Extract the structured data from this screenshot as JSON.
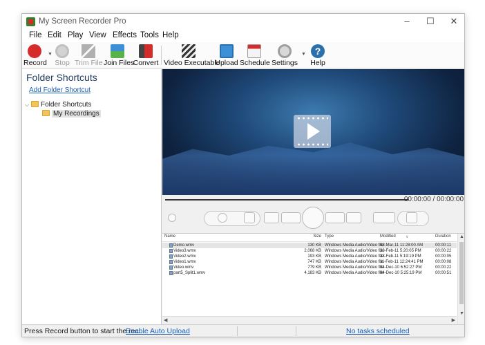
{
  "window": {
    "title": "My Screen Recorder Pro",
    "controls": {
      "minimize": "–",
      "maximize": "☐",
      "close": "✕"
    }
  },
  "menu": [
    "File",
    "Edit",
    "Play",
    "View",
    "Effects",
    "Tools",
    "Help"
  ],
  "toolbar": {
    "record": "Record",
    "stop": "Stop",
    "trim_file": "Trim File",
    "join_files": "Join Files",
    "convert": "Convert",
    "video_executable": "Video Executable",
    "upload": "Upload",
    "schedule": "Schedule",
    "settings": "Settings",
    "help": "Help"
  },
  "sidebar": {
    "title": "Folder Shortcuts",
    "add_link": "Add Folder Shortcut",
    "tree": {
      "root": "Folder Shortcuts",
      "child": "My Recordings"
    }
  },
  "player": {
    "time": "00:00:00 / 00:00:00"
  },
  "file_list": {
    "columns": {
      "name": "Name",
      "size": "Size",
      "type": "Type",
      "modified": "Modified",
      "duration": "Duration"
    },
    "rows": [
      {
        "name": "Demo.wmv",
        "size": "130 KB",
        "type": "Windows Media Audio/Video file",
        "modified": "08-Mar-11 11:28:00 AM",
        "duration": "00:00:11"
      },
      {
        "name": "Video3.wmv",
        "size": "2,068 KB",
        "type": "Windows Media Audio/Video file",
        "modified": "23-Feb-11 5:20:05 PM",
        "duration": "00:00:22"
      },
      {
        "name": "Video2.wmv",
        "size": "193 KB",
        "type": "Windows Media Audio/Video file",
        "modified": "23-Feb-11 5:19:19 PM",
        "duration": "00:00:05"
      },
      {
        "name": "Video1.wmv",
        "size": "747 KB",
        "type": "Windows Media Audio/Video file",
        "modified": "11-Feb-11 12:24:41 PM",
        "duration": "00:00:08"
      },
      {
        "name": "Video.wmv",
        "size": "779 KB",
        "type": "Windows Media Audio/Video file",
        "modified": "04-Dec-10 6:52:27 PM",
        "duration": "00:00:22"
      },
      {
        "name": "part5_Split1.wmv",
        "size": "4,183 KB",
        "type": "Windows Media Audio/Video file",
        "modified": "04-Dec-10 5:25:19 PM",
        "duration": "00:00:51"
      }
    ]
  },
  "status": {
    "hint": "Press Record button to start the rec...",
    "auto_upload": "Enable Auto Upload",
    "tasks": "No tasks scheduled"
  },
  "colors": {
    "record_red": "#d62b2b",
    "link_blue": "#1a5fb4",
    "video_bg": "#1f4a7a"
  }
}
